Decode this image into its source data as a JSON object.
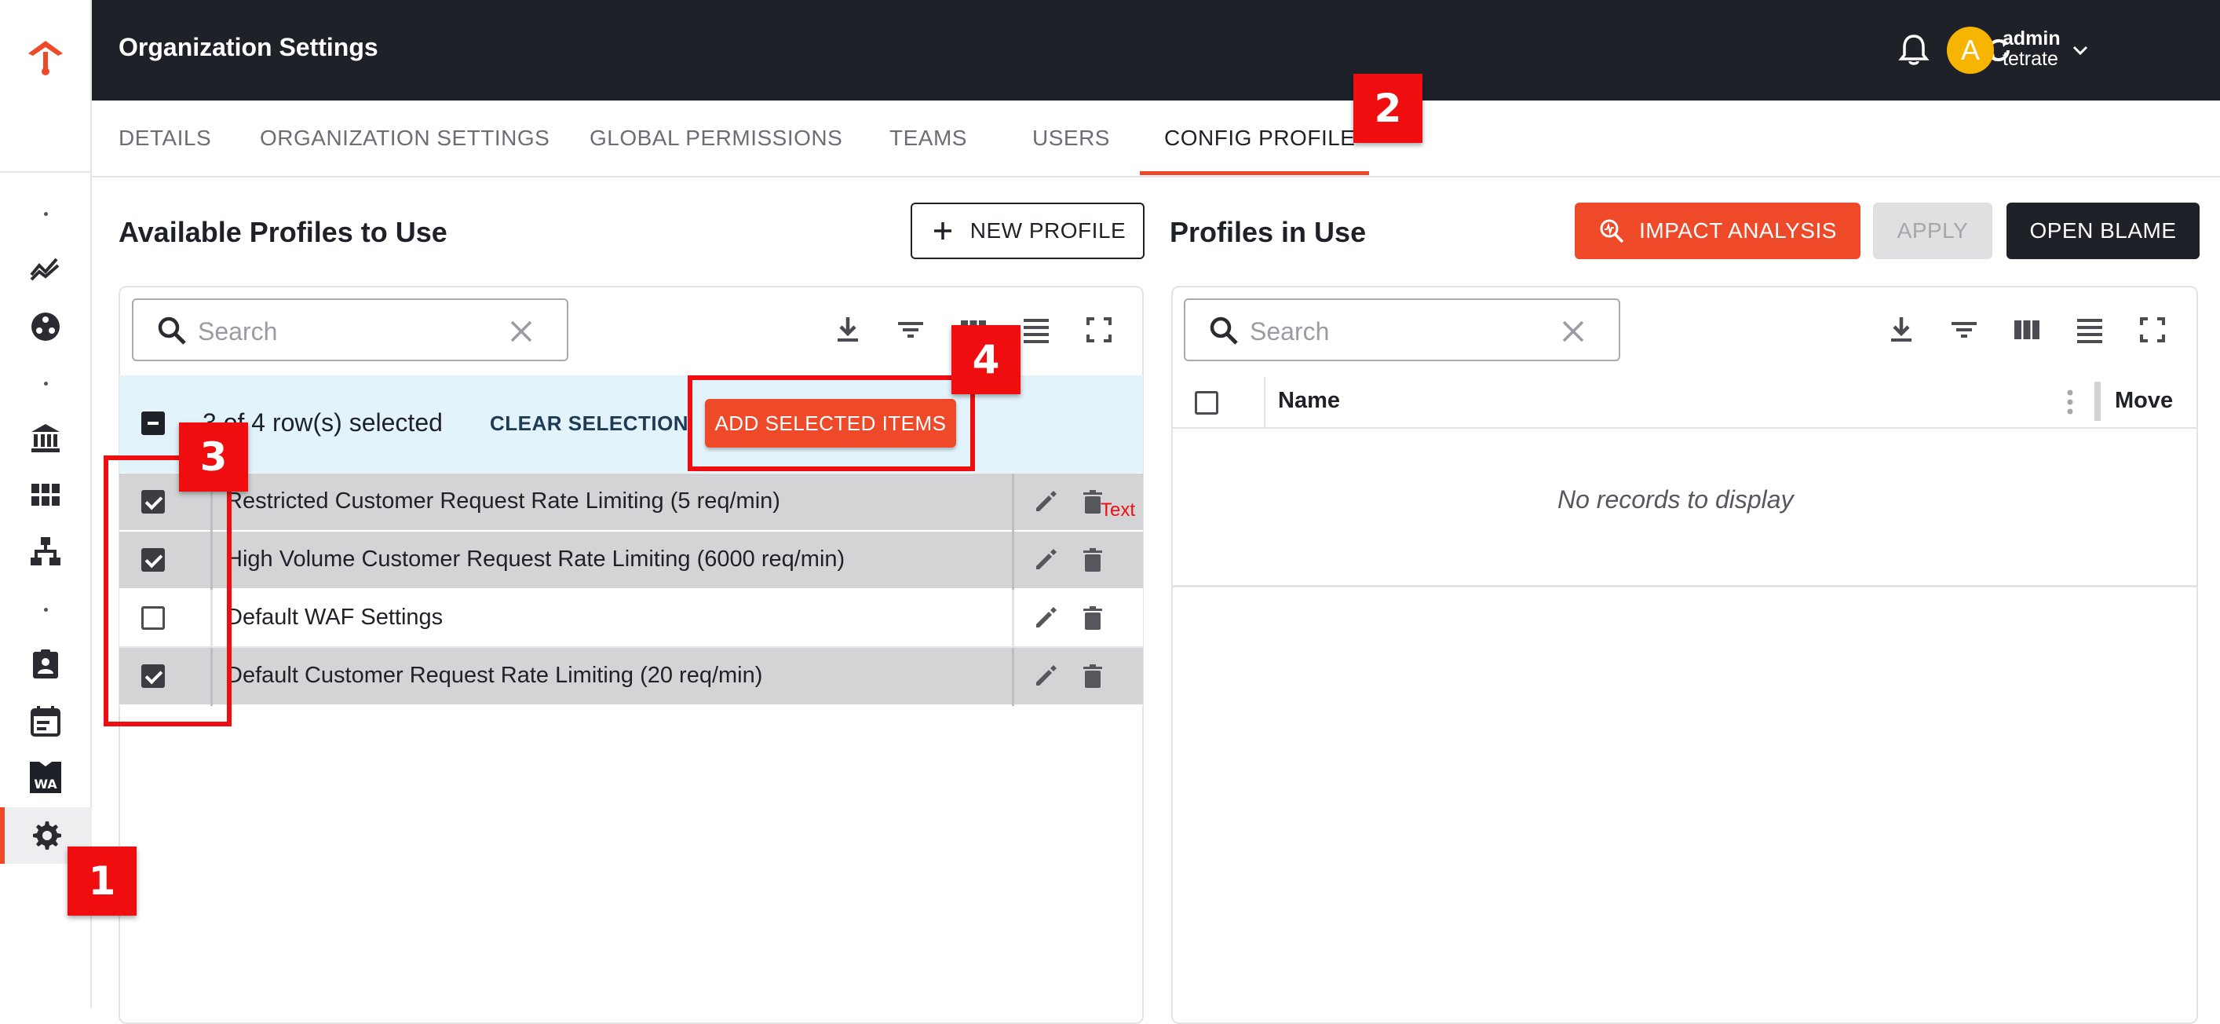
{
  "app": {
    "header_title": "Organization Settings",
    "user": {
      "avatar_letter": "A",
      "name": "admin",
      "org": "tetrate"
    }
  },
  "tabs": [
    {
      "label": "DETAILS"
    },
    {
      "label": "ORGANIZATION SETTINGS"
    },
    {
      "label": "GLOBAL PERMISSIONS"
    },
    {
      "label": "TEAMS"
    },
    {
      "label": "USERS"
    },
    {
      "label": "CONFIG PROFILE",
      "active": true
    }
  ],
  "left_panel": {
    "title": "Available Profiles to Use",
    "new_profile_label": "NEW PROFILE",
    "search_placeholder": "Search",
    "selection_text": "3 of 4 row(s) selected",
    "clear_selection_label": "CLEAR SELECTION",
    "add_selected_label": "ADD SELECTED ITEMS",
    "rows": [
      {
        "label": "Restricted Customer Request Rate Limiting (5 req/min)",
        "checked": true
      },
      {
        "label": "High Volume Customer Request Rate Limiting (6000 req/min)",
        "checked": true
      },
      {
        "label": "Default WAF Settings",
        "checked": false
      },
      {
        "label": "Default Customer Request Rate Limiting (20 req/min)",
        "checked": true
      }
    ]
  },
  "right_panel": {
    "title": "Profiles in Use",
    "impact_analysis_label": "IMPACT ANALYSIS",
    "apply_label": "APPLY",
    "open_blame_label": "OPEN BLAME",
    "search_placeholder": "Search",
    "col_name": "Name",
    "col_move": "Move",
    "empty_text": "No records to display"
  },
  "annotations": {
    "badge_1": "1",
    "badge_2": "2",
    "badge_3": "3",
    "badge_4": "4",
    "note_text": "Text"
  },
  "colors": {
    "accent": "#ee4a2a",
    "header_bg": "#1f2129",
    "annotation": "#f00d10",
    "selection_bg": "#e3f3fb",
    "selected_row_bg": "#d4d4d6"
  },
  "icons": {
    "rail": [
      "tetrate-logo-icon",
      "metrics-icon",
      "services-icon",
      "bank-icon",
      "grid-icon",
      "hierarchy-icon",
      "badge-icon",
      "calendar-icon",
      "waf-icon",
      "gear-icon"
    ],
    "header": [
      "bell-icon",
      "sync-icon",
      "chevron-down-icon"
    ],
    "toolbar": [
      "download-icon",
      "filter-icon",
      "columns-icon",
      "density-icon",
      "fullscreen-icon"
    ]
  }
}
